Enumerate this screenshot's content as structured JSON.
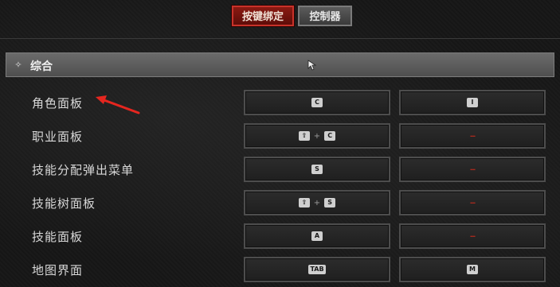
{
  "tabs": [
    {
      "label": "按键绑定",
      "active": true
    },
    {
      "label": "控制器",
      "active": false
    }
  ],
  "section": {
    "title": "综合",
    "icon": "collapse-icon"
  },
  "rows": [
    {
      "action": "角色面板",
      "primary": [
        "C"
      ],
      "secondary": [
        "I"
      ]
    },
    {
      "action": "职业面板",
      "primary": [
        "⇧",
        "+",
        "C"
      ],
      "secondary": "--"
    },
    {
      "action": "技能分配弹出菜单",
      "primary": [
        "S"
      ],
      "secondary": "--"
    },
    {
      "action": "技能树面板",
      "primary": [
        "⇧",
        "+",
        "S"
      ],
      "secondary": "--"
    },
    {
      "action": "技能面板",
      "primary": [
        "A"
      ],
      "secondary": "--"
    },
    {
      "action": "地图界面",
      "primary": [
        "TAB"
      ],
      "secondary": [
        "M"
      ]
    }
  ],
  "colors": {
    "accent_red": "#c8322a",
    "unbound_red": "#a42a1e",
    "annotation_arrow": "#e5261f"
  }
}
